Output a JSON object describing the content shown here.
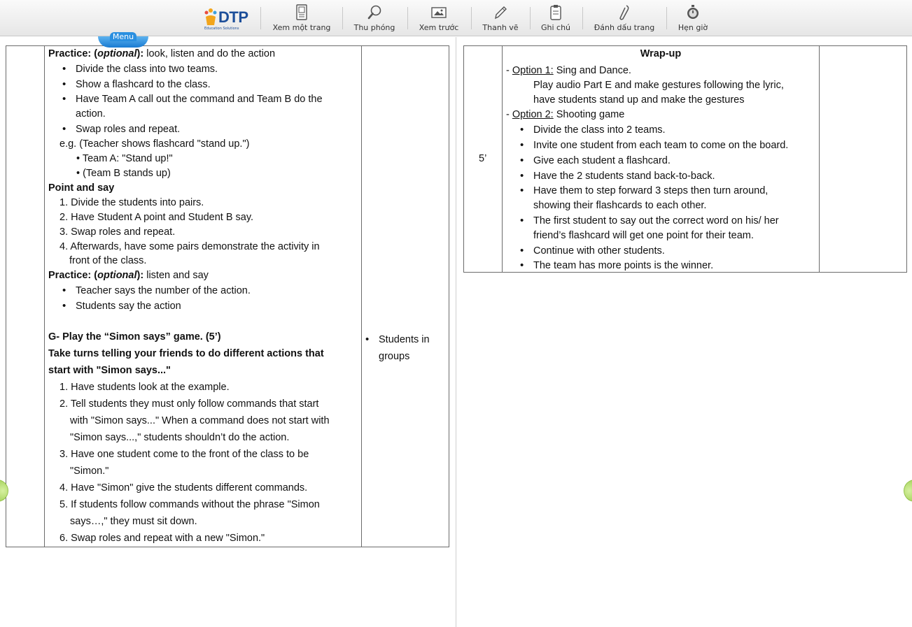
{
  "toolbar": {
    "logo_brand": "DTP",
    "logo_sub": "Education Solutions",
    "buttons": [
      {
        "label": "Xem một trang",
        "icon": "single-page-icon"
      },
      {
        "label": "Thu phóng",
        "icon": "zoom-icon"
      },
      {
        "label": "Xem trước",
        "icon": "preview-icon"
      },
      {
        "label": "Thanh vẽ",
        "icon": "pencil-icon"
      },
      {
        "label": "Ghi chú",
        "icon": "note-icon"
      },
      {
        "label": "Đánh dấu trang",
        "icon": "bookmark-icon"
      },
      {
        "label": "Hẹn giờ",
        "icon": "timer-icon"
      }
    ],
    "menu_label": "Menu"
  },
  "left_page": {
    "practice1": {
      "p1": "Practice: (",
      "p2": "optional",
      "p3": "):",
      "rest": " look, listen and do the action"
    },
    "practice1_items": [
      "Divide the class into two teams.",
      "Show a flashcard to the class.",
      "Have Team A call out the command and Team B do the",
      "action.",
      "Swap roles and repeat."
    ],
    "example": "e.g. (Teacher shows flashcard \"stand up.\")",
    "example_items": [
      "• Team A: \"Stand up!\"",
      "• (Team B stands up)"
    ],
    "point_say_title": "Point and say",
    "point_say_items": [
      "1. Divide the students into pairs.",
      "2. Have Student A point and Student B say.",
      "3. Swap roles and repeat.",
      "4. Afterwards, have some pairs demonstrate the activity in",
      "front of the class."
    ],
    "practice2": {
      "p1": "Practice: (",
      "p2": "optional",
      "p3": "):",
      "rest": " listen and say"
    },
    "practice2_items": [
      "Teacher says the number of the action.",
      "Students say the action"
    ],
    "game_title": "G- Play the “Simon says” game. (5’)",
    "game_sub1": "Take turns telling your friends to do different actions that",
    "game_sub2": "start with \"Simon says...\"",
    "game_lines": [
      "1. Have students look at the example.",
      "2. Tell students they must only follow commands that start",
      "with \"Simon says...\" When a command does not start with",
      "\"Simon says...,\" students shouldn’t do the action.",
      "3. Have one student come to the front of the class to be",
      "\"Simon.\"",
      "4. Have \"Simon\" give the students different commands.",
      "5. If students follow commands without the phrase \"Simon",
      "says…,\" they must sit down.",
      "6. Swap roles and repeat with a new \"Simon.\""
    ],
    "interaction": [
      "Students in",
      "groups"
    ]
  },
  "right_page": {
    "time": "5’",
    "title": "Wrap-up",
    "option1_dash": "- ",
    "option1_label": "Option 1:",
    "option1_rest": " Sing and Dance.",
    "option1_lines": [
      "Play audio Part E and make gestures following the lyric,",
      "have students stand up and make the gestures"
    ],
    "option2_dash": "- ",
    "option2_label": "Option 2:",
    "option2_rest": " Shooting game",
    "option2_items": [
      "Divide the class into 2 teams.",
      "Invite one student from each team to come on the board.",
      "Give each student a flashcard.",
      "Have the 2 students stand back-to-back.",
      "Have them to step forward 3 steps then turn around,",
      "showing their flashcards to each other.",
      "The first student to say out the correct word on his/ her",
      "friend’s flashcard will get one point for their team.",
      "Continue with other students.",
      "The team has more points is the winner."
    ]
  },
  "colors": {
    "brand": "#1d4f9a",
    "menu_tab": "#1a7bd1",
    "nav_arrow": "#a7d45e"
  }
}
